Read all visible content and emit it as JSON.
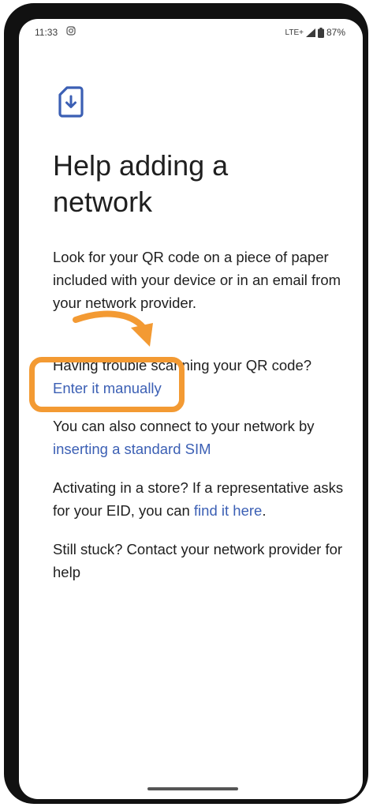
{
  "status_bar": {
    "time": "11:33",
    "network": "LTE+",
    "battery": "87%"
  },
  "page": {
    "title_line1": "Help adding a",
    "title_line2": "network",
    "intro": "Look for your QR code on a piece of paper included with your device or in an email from your network provider.",
    "trouble_text": "Having trouble scanning your QR code?",
    "enter_manually_link": "Enter it manually",
    "sim_text": "You can also connect to your network by",
    "sim_link": "inserting a standard SIM",
    "store_text": "Activating in a store? If a representative asks for your EID, you can",
    "find_link": "find it here",
    "store_end": ".",
    "stuck_text": "Still stuck? Contact your network provider for help"
  },
  "colors": {
    "link": "#3b5fb4",
    "annotation": "#f39a33",
    "icon": "#3b5fb4"
  },
  "icons": [
    "instagram-icon",
    "signal-icon",
    "battery-icon",
    "sim-download-icon",
    "annotation-arrow"
  ]
}
